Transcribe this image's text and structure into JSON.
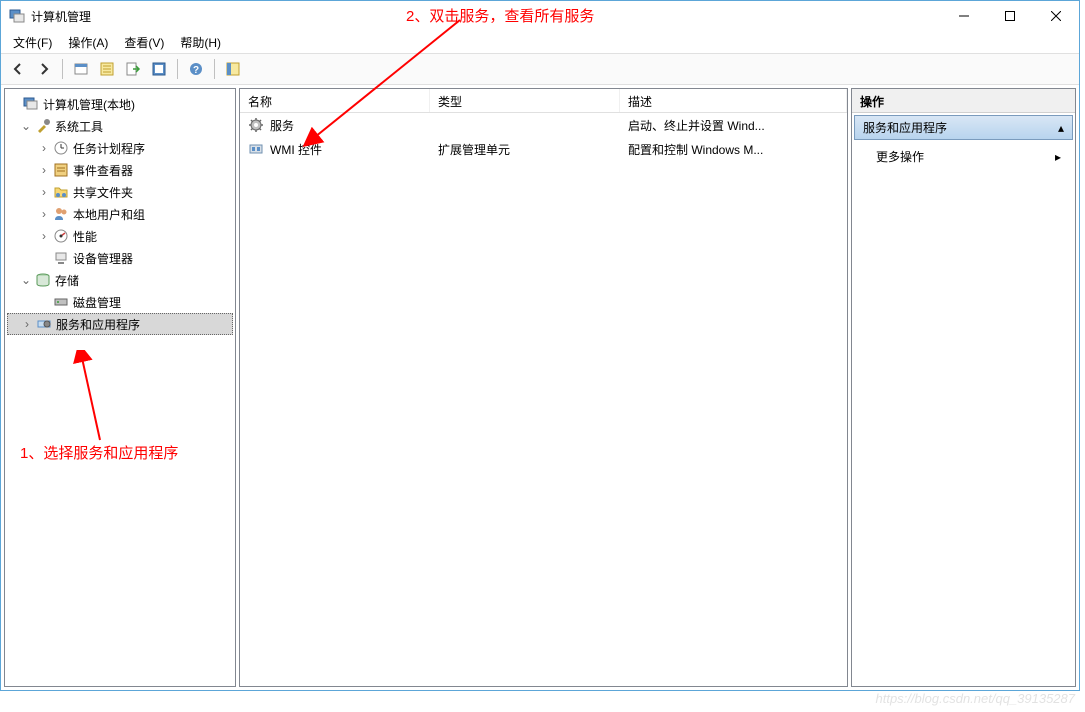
{
  "window": {
    "title": "计算机管理"
  },
  "menu": {
    "file": "文件(F)",
    "action": "操作(A)",
    "view": "查看(V)",
    "help": "帮助(H)"
  },
  "tree": {
    "root": "计算机管理(本地)",
    "system_tools": "系统工具",
    "task_scheduler": "任务计划程序",
    "event_viewer": "事件查看器",
    "shared_folders": "共享文件夹",
    "local_users": "本地用户和组",
    "performance": "性能",
    "device_manager": "设备管理器",
    "storage": "存储",
    "disk_management": "磁盘管理",
    "services_apps": "服务和应用程序"
  },
  "list": {
    "headers": {
      "name": "名称",
      "type": "类型",
      "desc": "描述"
    },
    "rows": [
      {
        "name": "服务",
        "type": "",
        "desc": "启动、终止并设置 Wind..."
      },
      {
        "name": "WMI 控件",
        "type": "扩展管理单元",
        "desc": "配置和控制 Windows M..."
      }
    ]
  },
  "actions": {
    "title": "操作",
    "section": "服务和应用程序",
    "more": "更多操作"
  },
  "annotations": {
    "a1": "1、选择服务和应用程序",
    "a2": "2、双击服务，查看所有服务"
  },
  "watermark": "https://blog.csdn.net/qq_39135287"
}
